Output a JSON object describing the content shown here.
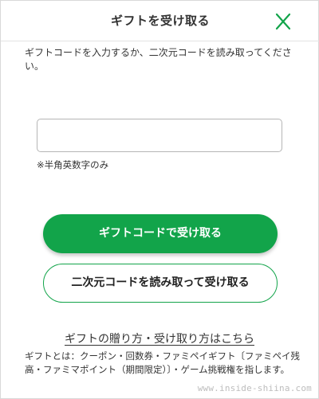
{
  "header": {
    "title": "ギフトを受け取る",
    "close_icon": "close-icon",
    "accent_color": "#12a44a"
  },
  "instruction": "ギフトコードを入力するか、二次元コードを読み取ってください。",
  "code_input": {
    "value": "",
    "placeholder": ""
  },
  "input_note": "※半角英数字のみ",
  "buttons": {
    "receive_with_code": "ギフトコードで受け取る",
    "receive_with_qr": "二次元コードを読み取って受け取る"
  },
  "howto_link": "ギフトの贈り方・受け取り方はこちら",
  "footnote": "ギフトとは：クーポン・回数券・ファミペイギフト〔ファミペイ残高・ファミマポイント（期間限定）〕・ゲーム挑戦権を指します。",
  "watermark": "www.inside-shiina.com"
}
